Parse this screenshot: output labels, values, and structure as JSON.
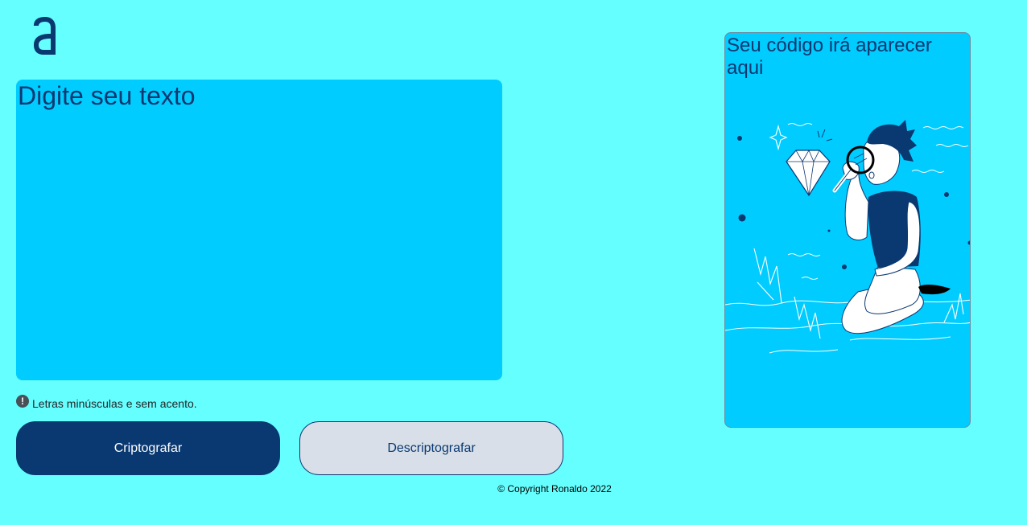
{
  "brand": {
    "logo_icon": "alura-a-logo-icon",
    "color": "#0a3871"
  },
  "input": {
    "placeholder": "Digite seu texto",
    "value": ""
  },
  "hint": {
    "icon": "exclamation-circle-icon",
    "text": "Letras minúsculas e sem acento."
  },
  "buttons": {
    "encrypt_label": "Criptografar",
    "decrypt_label": "Descriptografar"
  },
  "output": {
    "title": "Seu código irá aparecer aqui",
    "illustration": "person-with-magnifying-glass-diamond-illustration"
  },
  "footer": {
    "copyright": "© Copyright Ronaldo 2022"
  },
  "colors": {
    "background": "#66ffff",
    "panel": "#00ccff",
    "primary": "#0a3871",
    "secondary_button": "#d8dfe8"
  }
}
